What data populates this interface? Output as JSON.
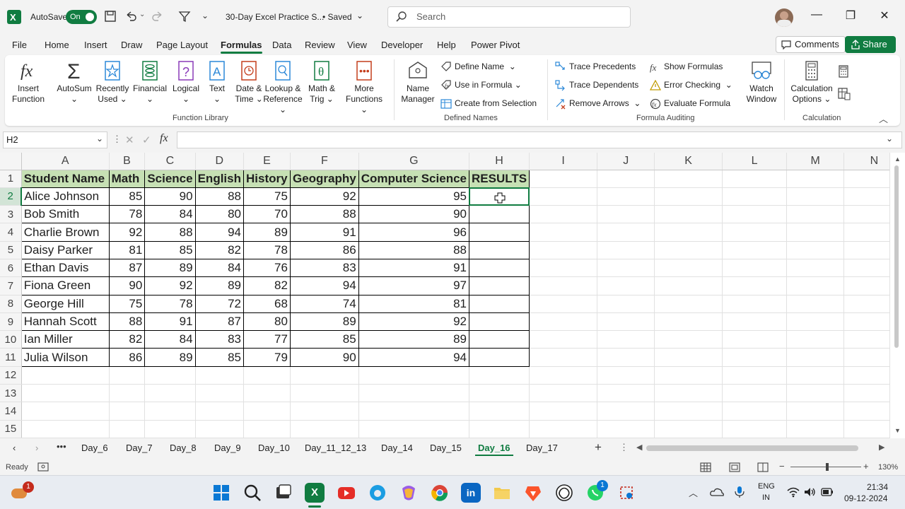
{
  "titlebar": {
    "autosave_label": "AutoSave",
    "autosave_state": "On",
    "file_title": "30-Day Excel Practice S...",
    "save_status": "• Saved",
    "search_placeholder": "Search"
  },
  "menu": {
    "items": [
      "File",
      "Home",
      "Insert",
      "Draw",
      "Page Layout",
      "Formulas",
      "Data",
      "Review",
      "View",
      "Developer",
      "Help",
      "Power Pivot"
    ],
    "active": "Formulas",
    "comments_label": "Comments",
    "share_label": "Share"
  },
  "ribbon": {
    "function_library": {
      "label": "Function Library",
      "insert_function": [
        "Insert",
        "Function"
      ],
      "autosum": "AutoSum",
      "recently_used": [
        "Recently",
        "Used"
      ],
      "financial": "Financial",
      "logical": "Logical",
      "text": "Text",
      "date_time": [
        "Date &",
        "Time"
      ],
      "lookup_reference": [
        "Lookup &",
        "Reference"
      ],
      "math_trig": [
        "Math &",
        "Trig"
      ],
      "more_functions": [
        "More",
        "Functions"
      ]
    },
    "defined_names": {
      "label": "Defined Names",
      "name_manager": [
        "Name",
        "Manager"
      ],
      "define_name": "Define Name",
      "use_in_formula": "Use in Formula",
      "create_from_selection": "Create from Selection"
    },
    "formula_auditing": {
      "label": "Formula Auditing",
      "trace_precedents": "Trace Precedents",
      "trace_dependents": "Trace Dependents",
      "remove_arrows": "Remove Arrows",
      "show_formulas": "Show Formulas",
      "error_checking": "Error Checking",
      "evaluate_formula": "Evaluate Formula",
      "watch_window": [
        "Watch",
        "Window"
      ]
    },
    "calculation": {
      "label": "Calculation",
      "calculation_options": [
        "Calculation",
        "Options"
      ]
    }
  },
  "formula_bar": {
    "name_box": "H2",
    "fx": "fx",
    "content": ""
  },
  "sheet": {
    "columns": [
      "A",
      "B",
      "C",
      "D",
      "E",
      "F",
      "G",
      "H",
      "I",
      "J",
      "K",
      "L",
      "M",
      "N"
    ],
    "rows": [
      "1",
      "2",
      "3",
      "4",
      "5",
      "6",
      "7",
      "8",
      "9",
      "10",
      "11",
      "12",
      "13",
      "14",
      "15"
    ],
    "headers": [
      "Student Name",
      "Math",
      "Science",
      "English",
      "History",
      "Geography",
      "Computer Science",
      "RESULTS"
    ],
    "data": [
      [
        "Alice Johnson",
        "85",
        "90",
        "88",
        "75",
        "92",
        "95",
        ""
      ],
      [
        "Bob Smith",
        "78",
        "84",
        "80",
        "70",
        "88",
        "90",
        ""
      ],
      [
        "Charlie Brown",
        "92",
        "88",
        "94",
        "89",
        "91",
        "96",
        ""
      ],
      [
        "Daisy Parker",
        "81",
        "85",
        "82",
        "78",
        "86",
        "88",
        ""
      ],
      [
        "Ethan Davis",
        "87",
        "89",
        "84",
        "76",
        "83",
        "91",
        ""
      ],
      [
        "Fiona Green",
        "90",
        "92",
        "89",
        "82",
        "94",
        "97",
        ""
      ],
      [
        "George Hill",
        "75",
        "78",
        "72",
        "68",
        "74",
        "81",
        ""
      ],
      [
        "Hannah Scott",
        "88",
        "91",
        "87",
        "80",
        "89",
        "92",
        ""
      ],
      [
        "Ian Miller",
        "82",
        "84",
        "83",
        "77",
        "85",
        "89",
        ""
      ],
      [
        "Julia Wilson",
        "86",
        "89",
        "85",
        "79",
        "90",
        "94",
        ""
      ]
    ],
    "selected_cell": "H2"
  },
  "sheet_tabs": {
    "tabs": [
      "Day_6",
      "Day_7",
      "Day_8",
      "Day_9",
      "Day_10",
      "Day_11_12_13",
      "Day_14",
      "Day_15",
      "Day_16",
      "Day_17"
    ],
    "active": "Day_16"
  },
  "status": {
    "ready": "Ready",
    "zoom": "130%"
  },
  "taskbar": {
    "lang_top": "ENG",
    "lang_bottom": "IN",
    "time": "21:34",
    "date": "09-12-2024",
    "notif_badge_weather": "1",
    "notif_badge_whatsapp": "1"
  },
  "colors": {
    "excel_green": "#107c41",
    "header_fill": "#c6e0b4",
    "selection_highlight": "#d2e4d6"
  }
}
